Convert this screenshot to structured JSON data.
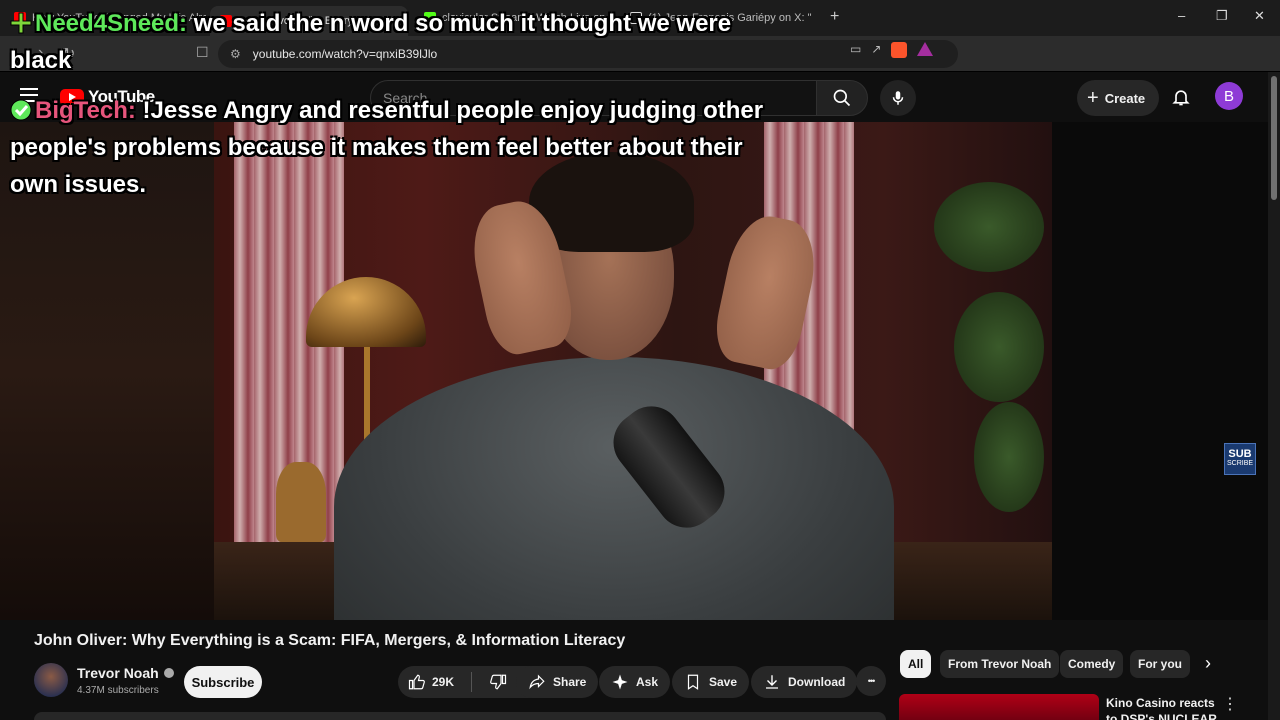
{
  "browser": {
    "tabs": [
      {
        "title": "How YouTube Changed My Life Already",
        "favicon_color": "#ff0000"
      },
      {
        "title": "John Oliver: Why Everything",
        "favicon_color": "#ff0000",
        "active": true
      },
      {
        "title": "clavicular Stream - Watch Live on Kick",
        "favicon_color": "#53fc18"
      },
      {
        "title": "(1) Jean-François Gariépy on X: \"",
        "favicon_color": "#ffffff"
      }
    ],
    "new_tab": "+",
    "url": "youtube.com/watch?v=qnxiB39lJlo",
    "window_controls": {
      "minimize": "–",
      "maximize": "❐",
      "close": "✕"
    }
  },
  "youtube": {
    "logo_text": "YouTube",
    "search_placeholder": "Search",
    "create_label": "Create",
    "avatar_letter": "B"
  },
  "chat_overlay": [
    {
      "user": "Need4Sneed:",
      "message": " we said the n word so much it thought we were black",
      "badge": "plus",
      "color": "#5ee85a"
    },
    {
      "user": "BigTech:",
      "message": " !Jesse Angry and resentful people enjoy judging other people's problems because it makes them feel better about their own issues.",
      "badge": "check",
      "color": "#e6557c"
    }
  ],
  "video": {
    "title": "John Oliver: Why Everything is a Scam: FIFA, Mergers, & Information Literacy",
    "subscribe_badge": "SUB",
    "subscribe_badge_small": "SCRIBE"
  },
  "channel": {
    "name": "Trevor Noah",
    "subscribers": "4.37M subscribers",
    "subscribe_label": "Subscribe"
  },
  "actions": {
    "likes": "29K",
    "share": "Share",
    "ask": "Ask",
    "save": "Save",
    "download": "Download",
    "more": "•••"
  },
  "chips": [
    "All",
    "From Trevor Noah",
    "Comedy",
    "For you"
  ],
  "recommendation": {
    "title": "Kino Casino reacts to DSP's NUCLEAR"
  }
}
